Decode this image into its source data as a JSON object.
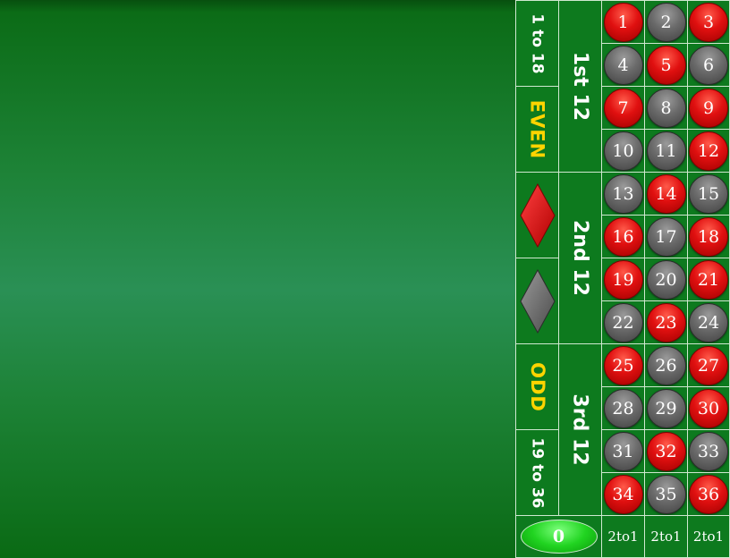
{
  "table": {
    "outside_bets": {
      "low": "1 to 18",
      "even": "EVEN",
      "red_icon": "red-diamond",
      "black_icon": "black-diamond",
      "odd": "ODD",
      "high": "19 to 36"
    },
    "dozens": [
      "1st 12",
      "2nd 12",
      "3rd 12"
    ],
    "zero": "0",
    "columns": [
      "2to1",
      "2to1",
      "2to1"
    ],
    "rows": [
      [
        {
          "n": "1",
          "c": "red"
        },
        {
          "n": "2",
          "c": "black"
        },
        {
          "n": "3",
          "c": "red"
        }
      ],
      [
        {
          "n": "4",
          "c": "black"
        },
        {
          "n": "5",
          "c": "red"
        },
        {
          "n": "6",
          "c": "black"
        }
      ],
      [
        {
          "n": "7",
          "c": "red"
        },
        {
          "n": "8",
          "c": "black"
        },
        {
          "n": "9",
          "c": "red"
        }
      ],
      [
        {
          "n": "10",
          "c": "black"
        },
        {
          "n": "11",
          "c": "black"
        },
        {
          "n": "12",
          "c": "red"
        }
      ],
      [
        {
          "n": "13",
          "c": "black"
        },
        {
          "n": "14",
          "c": "red"
        },
        {
          "n": "15",
          "c": "black"
        }
      ],
      [
        {
          "n": "16",
          "c": "red"
        },
        {
          "n": "17",
          "c": "black"
        },
        {
          "n": "18",
          "c": "red"
        }
      ],
      [
        {
          "n": "19",
          "c": "red"
        },
        {
          "n": "20",
          "c": "black"
        },
        {
          "n": "21",
          "c": "red"
        }
      ],
      [
        {
          "n": "22",
          "c": "black"
        },
        {
          "n": "23",
          "c": "red"
        },
        {
          "n": "24",
          "c": "black"
        }
      ],
      [
        {
          "n": "25",
          "c": "red"
        },
        {
          "n": "26",
          "c": "black"
        },
        {
          "n": "27",
          "c": "red"
        }
      ],
      [
        {
          "n": "28",
          "c": "black"
        },
        {
          "n": "29",
          "c": "black"
        },
        {
          "n": "30",
          "c": "red"
        }
      ],
      [
        {
          "n": "31",
          "c": "black"
        },
        {
          "n": "32",
          "c": "red"
        },
        {
          "n": "33",
          "c": "black"
        }
      ],
      [
        {
          "n": "34",
          "c": "red"
        },
        {
          "n": "35",
          "c": "black"
        },
        {
          "n": "36",
          "c": "red"
        }
      ]
    ]
  },
  "colors": {
    "felt": "#1d8236",
    "red": "#e01010",
    "black": "#6a6a6a",
    "zero_green": "#21d421",
    "label_yellow": "#ffd400"
  }
}
